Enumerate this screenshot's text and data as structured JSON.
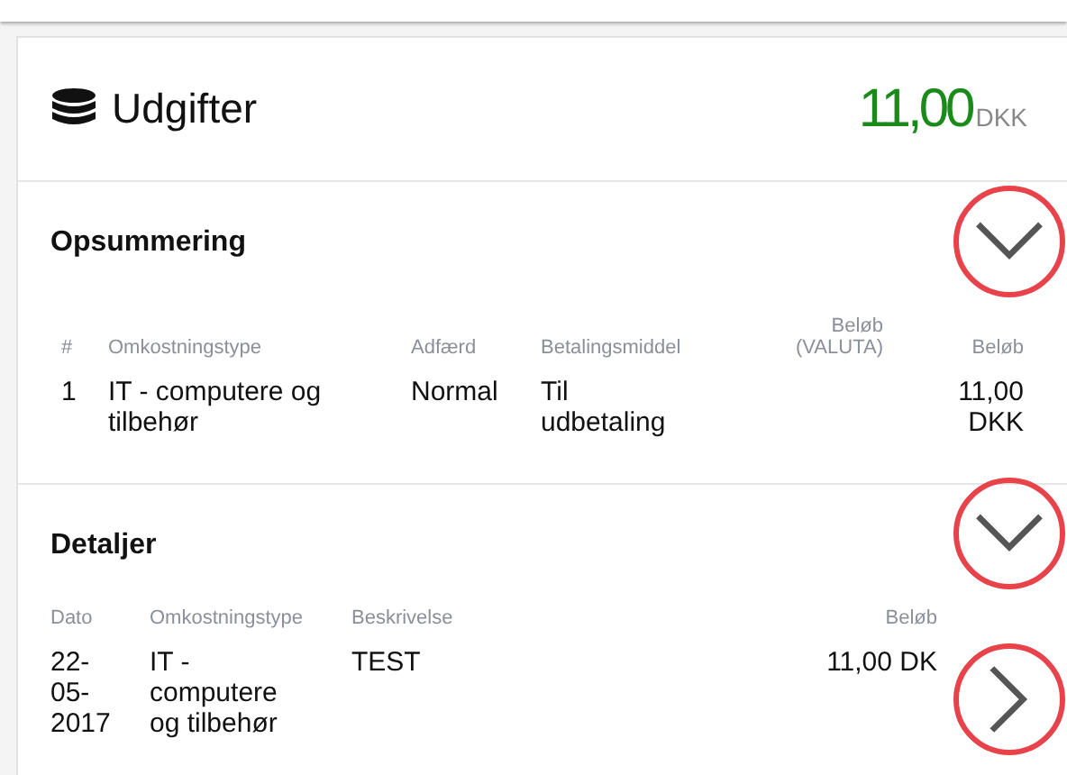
{
  "header": {
    "title": "Udgifter",
    "amount": "11,00",
    "currency": "DKK"
  },
  "summary": {
    "title": "Opsummering",
    "expanded": false,
    "columns": [
      "#",
      "Omkostningstype",
      "Adfærd",
      "Betalingsmiddel",
      "Beløb (VALUTA)",
      "Beløb"
    ],
    "rows": [
      [
        "1",
        "IT - computere og tilbehør",
        "Normal",
        "Til udbetaling",
        "",
        "11,00 DKK"
      ]
    ]
  },
  "details": {
    "title": "Detaljer",
    "expanded": false,
    "columns": [
      "Dato",
      "Omkostningstype",
      "Beskrivelse",
      "Beløb"
    ],
    "rows": [
      {
        "cells": [
          "22-05-2017",
          "IT - computere og tilbehør",
          "TEST",
          "11,00 DK"
        ]
      }
    ]
  }
}
